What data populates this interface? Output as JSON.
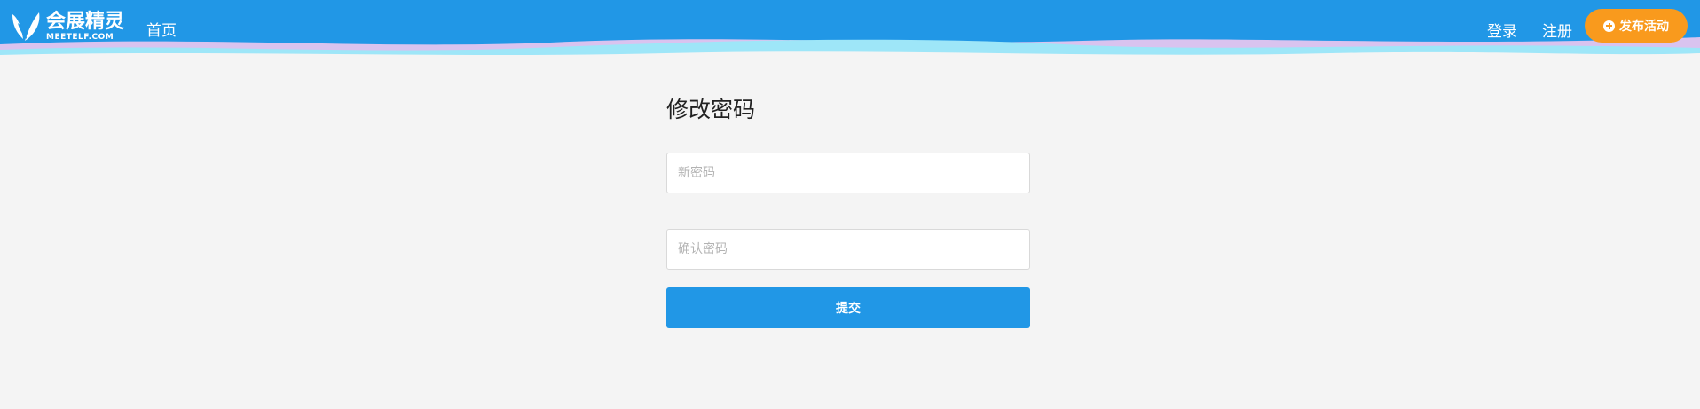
{
  "header": {
    "logo": {
      "name_cn": "会展精灵",
      "name_en": "MEETELF.COM"
    },
    "nav": {
      "home": "首页",
      "login": "登录",
      "register": "注册"
    },
    "publish_button": "发布活动",
    "colors": {
      "bar": "#2197e6",
      "publish": "#f99a1d"
    }
  },
  "main": {
    "title": "修改密码",
    "new_password": {
      "placeholder": "新密码",
      "value": ""
    },
    "confirm_password": {
      "placeholder": "确认密码",
      "value": ""
    },
    "submit_button": "提交"
  }
}
